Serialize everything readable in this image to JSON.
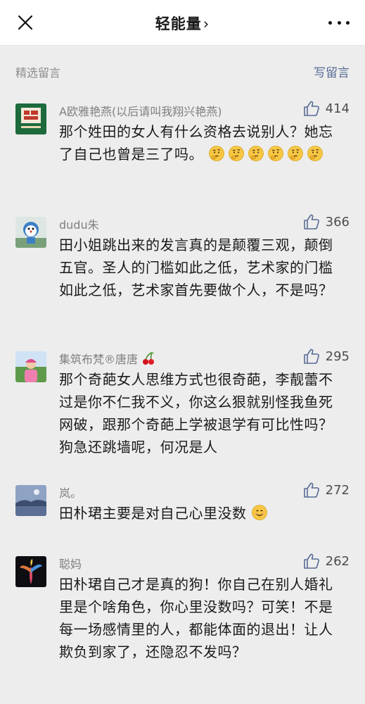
{
  "header": {
    "title": "轻能量",
    "chevron": "›"
  },
  "section": {
    "label": "精选留言",
    "write_label": "写留言"
  },
  "comments": [
    {
      "name": "A欧雅艳燕(以后请叫我翔兴艳燕)",
      "likes": "414",
      "text": "那个姓田的女人有什么资格去说别人？她忘了自己也曾是三了吗。",
      "emoji": "thinking-face-icon",
      "emoji_count": 6
    },
    {
      "name": "dudu朱",
      "likes": "366",
      "text": "田小姐跳出来的发言真的是颠覆三观，颠倒五官。圣人的门槛如此之低，艺术家的门槛如此之低，艺术家首先要做个人，不是吗？"
    },
    {
      "name": "集筑布梵®唐唐",
      "likes": "295",
      "name_emoji": "cherries-icon",
      "text": "那个奇葩女人思维方式也很奇葩，李靓蕾不过是你不仁我不义，你这么狠就别怪我鱼死网破，跟那个奇葩上学被退学有可比性吗？狗急还跳墙呢，何况是人"
    },
    {
      "name": "岚。",
      "likes": "272",
      "text": "田朴珺主要是对自己心里没数",
      "emoji": "smiling-face-icon",
      "emoji_count": 1
    },
    {
      "name": "聪妈",
      "likes": "262",
      "text": "田朴珺自己才是真的狗！你自己在别人婚礼里是个啥角色，你心里没数吗？可笑！不是每一场感情里的人，都能体面的退出！让人欺负到家了，还隐忍不发吗？"
    }
  ]
}
